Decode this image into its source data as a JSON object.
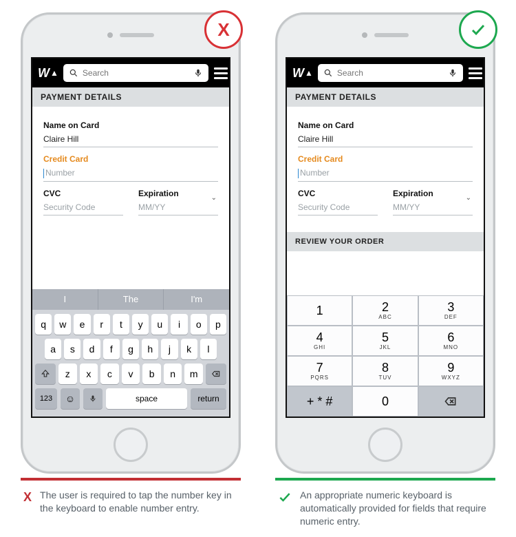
{
  "search": {
    "placeholder": "Search"
  },
  "section_title": "PAYMENT DETAILS",
  "form": {
    "name_label": "Name on Card",
    "name_value": "Claire Hill",
    "card_label": "Credit Card",
    "card_placeholder": "Number",
    "cvc_label": "CVC",
    "cvc_placeholder": "Security Code",
    "exp_label": "Expiration",
    "exp_placeholder": "MM/YY"
  },
  "predictions": [
    "I",
    "The",
    "I'm"
  ],
  "qwerty": {
    "row1": [
      "q",
      "w",
      "e",
      "r",
      "t",
      "y",
      "u",
      "i",
      "o",
      "p"
    ],
    "row2": [
      "a",
      "s",
      "d",
      "f",
      "g",
      "h",
      "j",
      "k",
      "l"
    ],
    "row3": [
      "z",
      "x",
      "c",
      "v",
      "b",
      "n",
      "m"
    ],
    "num_label": "123",
    "space_label": "space",
    "return_label": "return"
  },
  "numpad": {
    "keys": [
      [
        {
          "d": "1",
          "s": ""
        },
        {
          "d": "2",
          "s": "ABC"
        },
        {
          "d": "3",
          "s": "DEF"
        }
      ],
      [
        {
          "d": "4",
          "s": "GHI"
        },
        {
          "d": "5",
          "s": "JKL"
        },
        {
          "d": "6",
          "s": "MNO"
        }
      ],
      [
        {
          "d": "7",
          "s": "PQRS"
        },
        {
          "d": "8",
          "s": "TUV"
        },
        {
          "d": "9",
          "s": "WXYZ"
        }
      ]
    ],
    "sym": "+ * #",
    "zero": "0"
  },
  "review_title": "REVIEW YOUR ORDER",
  "captions": {
    "bad": "The user is required to tap the number key in the keyboard to enable number entry.",
    "good": "An appropriate numeric keyboard is automatically provided for fields that require numeric entry."
  },
  "marks": {
    "bad": "X"
  }
}
